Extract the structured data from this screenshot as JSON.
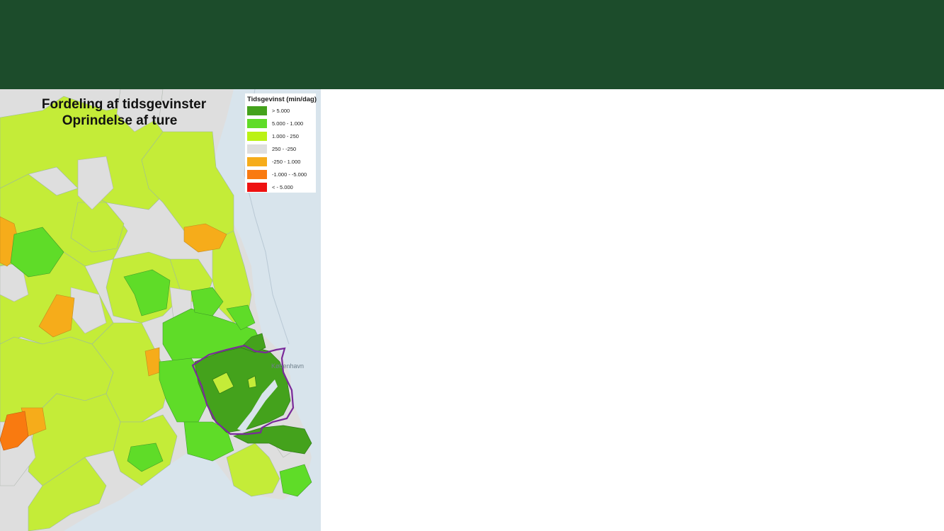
{
  "map": {
    "title_line1": "Fordeling af tidsgevinster",
    "title_line2": "Oprindelse af ture",
    "place_label": "København",
    "legend": {
      "title": "Tidsgevinst (min/dag)",
      "items": [
        {
          "label": "> 5.000",
          "color": "#44a21c"
        },
        {
          "label": "5.000 - 1.000",
          "color": "#5fdc28"
        },
        {
          "label": "1.000 - 250",
          "color": "#bbf214"
        },
        {
          "label": "250 - -250",
          "color": "#dedede"
        },
        {
          "label": "-250 - 1.000",
          "color": "#f6ac1a"
        },
        {
          "label": "-1.000 - -5.000",
          "color": "#f97a10"
        },
        {
          "label": "< - 5.000",
          "color": "#ee1111"
        }
      ]
    },
    "colors": {
      "header": "#1c4c2b",
      "sea": "#d8e4ec",
      "yellow_green": "#c4ec38",
      "gray": "#dedede",
      "boundary": "#7a2a9a"
    }
  }
}
